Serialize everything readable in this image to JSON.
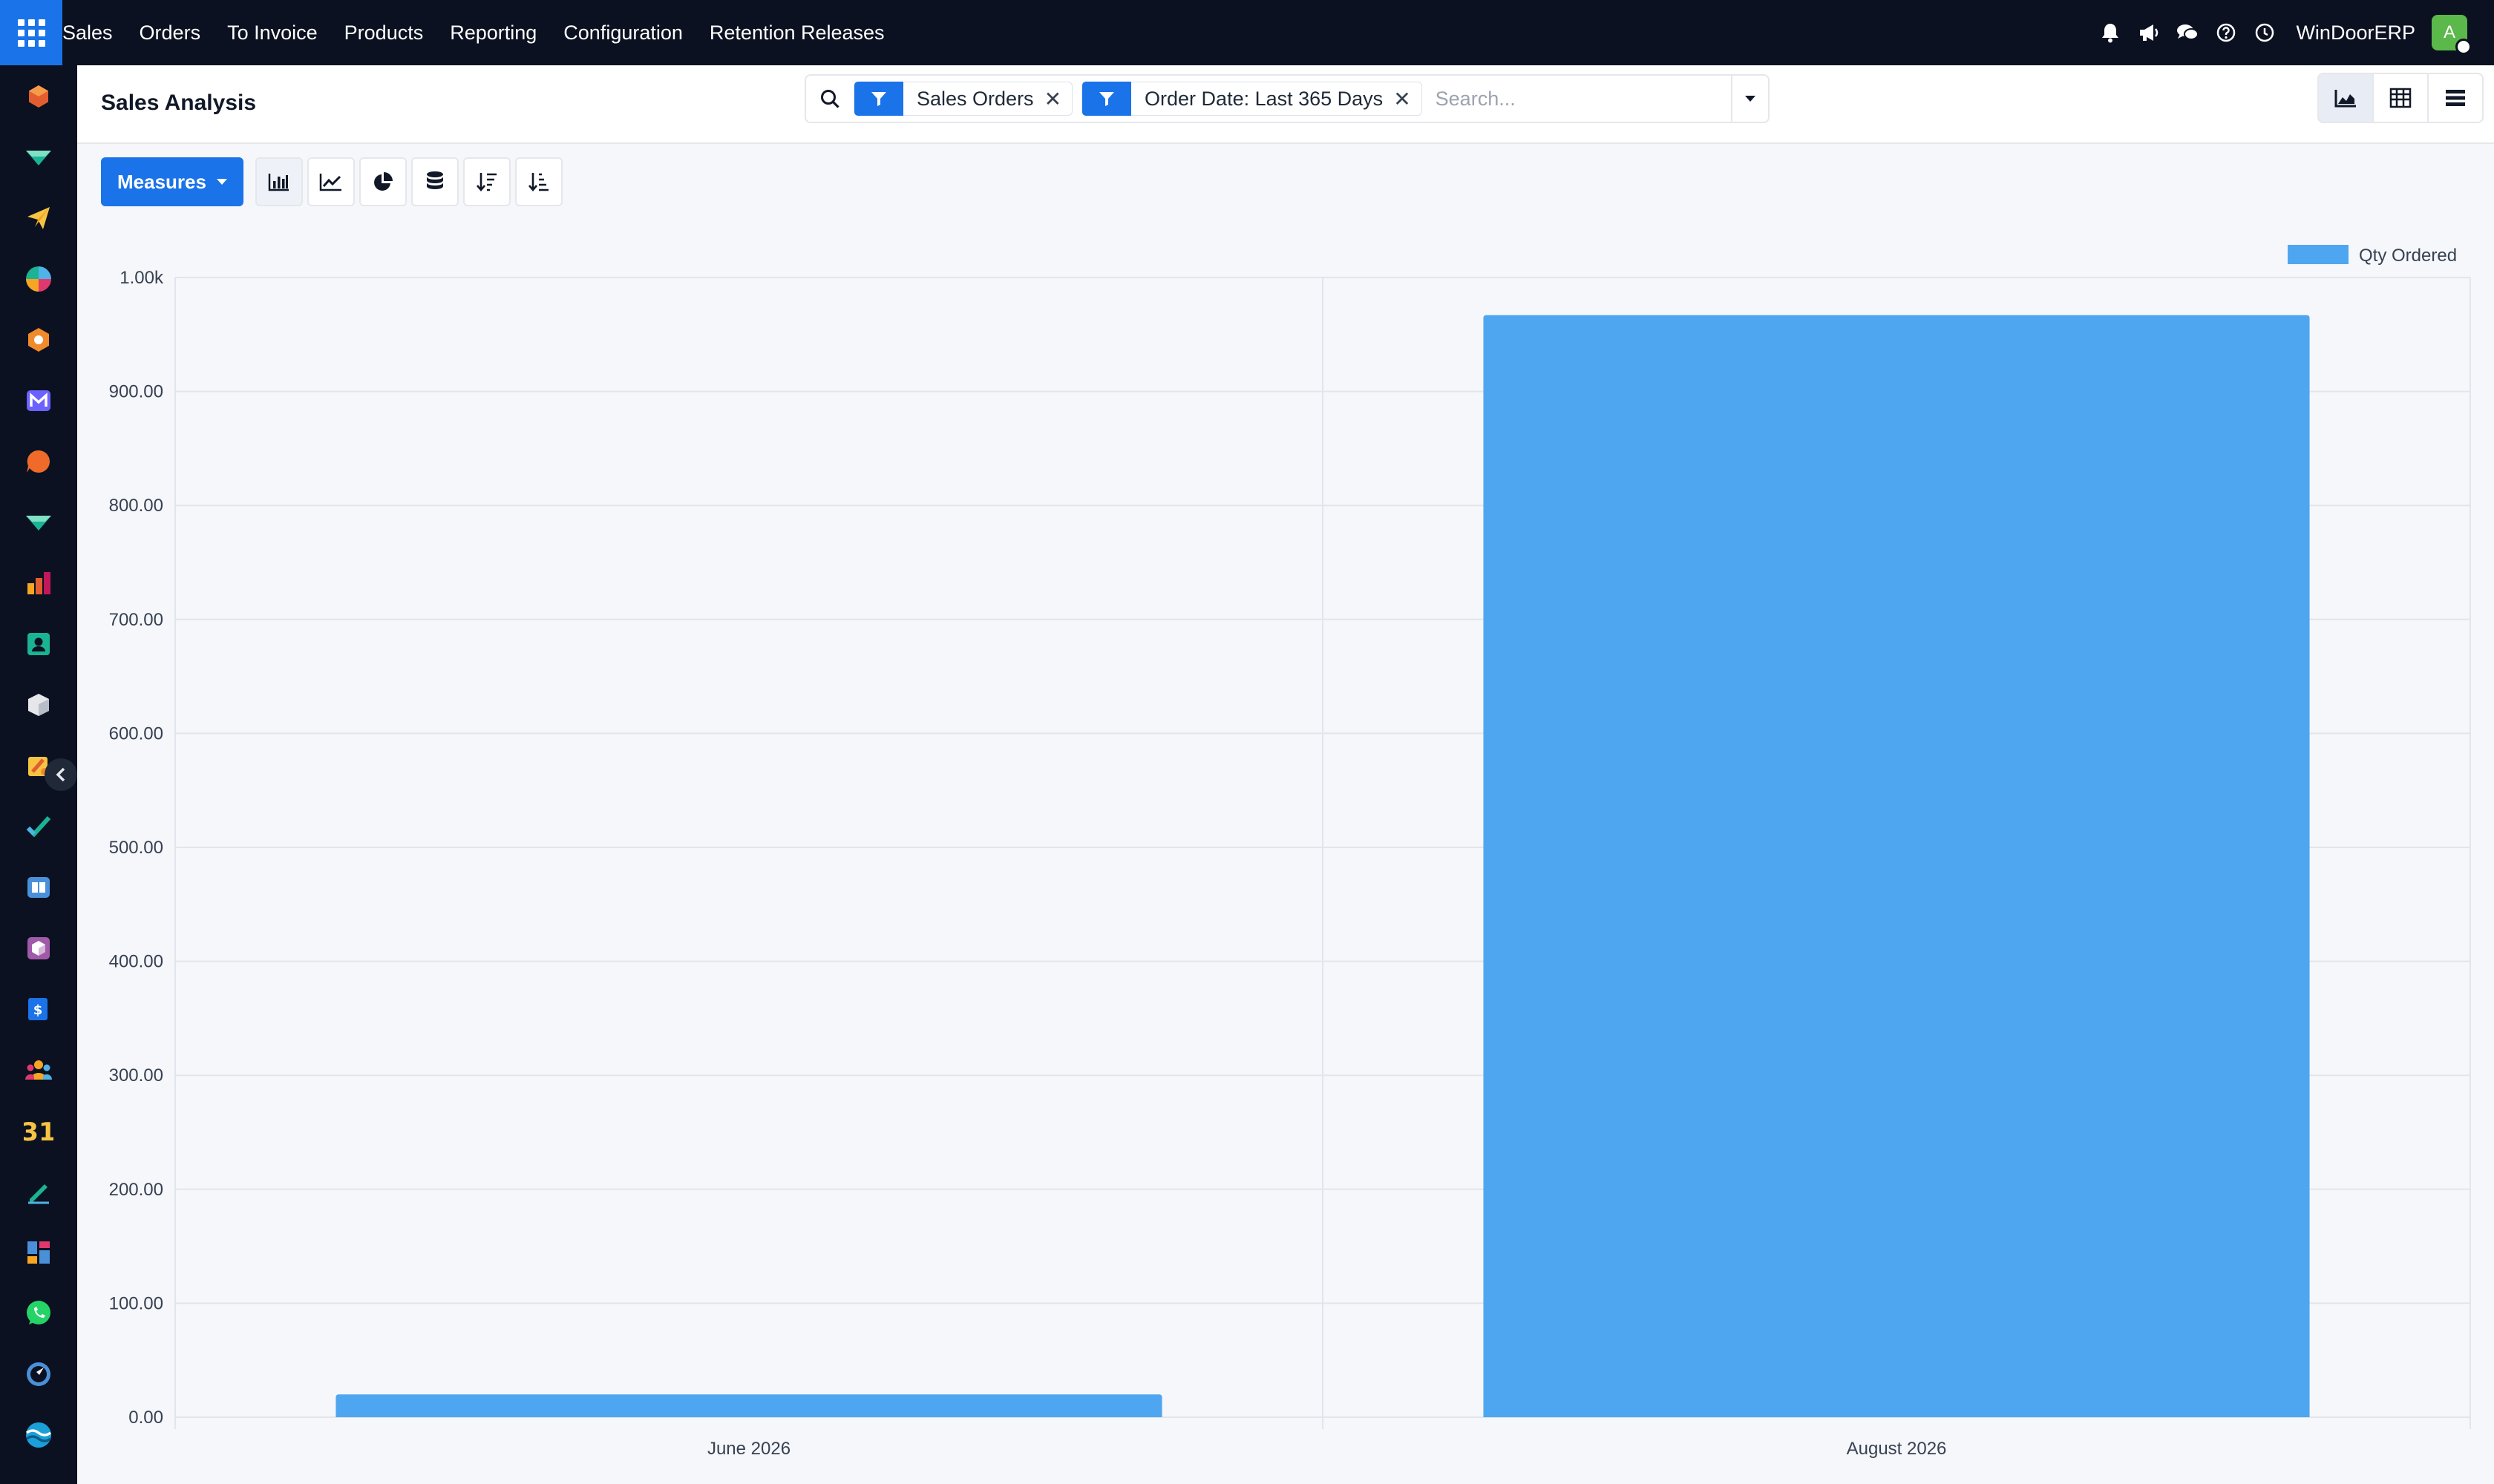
{
  "navbar": {
    "app_name": "Sales",
    "menu": [
      "Orders",
      "To Invoice",
      "Products",
      "Reporting",
      "Configuration",
      "Retention Releases"
    ],
    "company": "WinDoorERP",
    "avatar_letter": "A"
  },
  "sidebar": {
    "apps": [
      {
        "icon": "cube-icon",
        "color": "#e25d2f"
      },
      {
        "icon": "discuss-icon",
        "color": "#1ab394"
      },
      {
        "icon": "paper-plane-icon",
        "color": "#f6c343"
      },
      {
        "icon": "pie-app-icon",
        "color": "#e0386e"
      },
      {
        "icon": "hexagon-icon",
        "color": "#f08a2a"
      },
      {
        "icon": "mail-icon",
        "color": "#6c63ff"
      },
      {
        "icon": "chat-bubble-icon",
        "color": "#f06b2a"
      },
      {
        "icon": "discuss-icon",
        "color": "#1ab394"
      },
      {
        "icon": "bars-icon",
        "color": "#e25d2f"
      },
      {
        "icon": "contact-card-icon",
        "color": "#1ab394"
      },
      {
        "icon": "box-icon",
        "color": "#e5e7eb"
      },
      {
        "icon": "puzzle-icon",
        "color": "#f6c343"
      },
      {
        "icon": "checkmark-icon",
        "color": "#1ab394"
      },
      {
        "icon": "book-icon",
        "color": "#4a90d9"
      },
      {
        "icon": "package-icon",
        "color": "#a05aa9"
      },
      {
        "icon": "invoice-icon",
        "color": "#1a73e8"
      },
      {
        "icon": "team-icon",
        "color": "#f6a623"
      },
      {
        "icon": "calendar-icon",
        "color": "#f6c343"
      },
      {
        "icon": "sign-icon",
        "color": "#1ab394"
      },
      {
        "icon": "dashboard-icon",
        "color": "#4a90d9"
      },
      {
        "icon": "whatsapp-icon",
        "color": "#25d366"
      },
      {
        "icon": "compass-icon",
        "color": "#4a90d9"
      },
      {
        "icon": "discuss-wave-icon",
        "color": "#1a9fd8"
      }
    ]
  },
  "control": {
    "title": "Sales Analysis",
    "facets": [
      {
        "label": "Sales Orders"
      },
      {
        "label": "Order Date: Last 365 Days"
      }
    ],
    "search_placeholder": "Search..."
  },
  "toolbar": {
    "measures_label": "Measures"
  },
  "colors": {
    "accent": "#1a73e8",
    "bar": "#4fa6f0",
    "topbar": "#0b1120"
  },
  "chart_data": {
    "type": "bar",
    "categories": [
      "June 2026",
      "August 2026"
    ],
    "series": [
      {
        "name": "Qty Ordered",
        "values": [
          20,
          967
        ]
      }
    ],
    "ylim": [
      0,
      1000
    ],
    "yticks": [
      0,
      100,
      200,
      300,
      400,
      500,
      600,
      700,
      800,
      900,
      1000
    ],
    "ytick_labels": [
      "0.00",
      "100.00",
      "200.00",
      "300.00",
      "400.00",
      "500.00",
      "600.00",
      "700.00",
      "800.00",
      "900.00",
      "1.00k"
    ],
    "legend": "top-right",
    "grid": true
  }
}
